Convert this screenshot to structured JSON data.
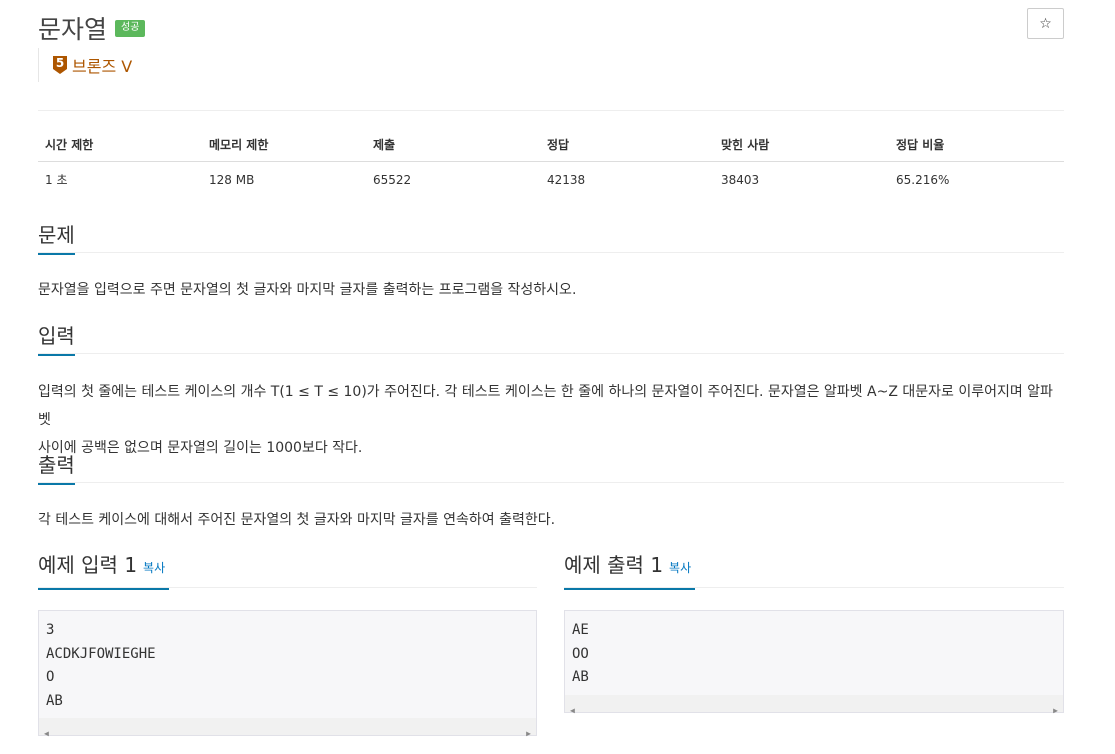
{
  "problem": {
    "title": "문자열",
    "result_badge": "성공",
    "tier_number": "5",
    "tier_label": "브론즈 V",
    "star_icon": "☆"
  },
  "info_table": {
    "headers": [
      "시간 제한",
      "메모리 제한",
      "제출",
      "정답",
      "맞힌 사람",
      "정답 비율"
    ],
    "values": [
      "1 초",
      "128 MB",
      "65522",
      "42138",
      "38403",
      "65.216%"
    ]
  },
  "sections": {
    "description": {
      "heading": "문제",
      "text": "문자열을 입력으로 주면 문자열의 첫 글자와 마지막 글자를 출력하는 프로그램을 작성하시오."
    },
    "input": {
      "heading": "입력",
      "text_line1": "입력의 첫 줄에는 테스트 케이스의 개수 T(1 ≤ T ≤ 10)가 주어진다. 각 테스트 케이스는 한 줄에 하나의 문자열이 주어진다. 문자열은 알파벳 A~Z 대문자로 이루어지며 알파벳",
      "text_line2": "사이에 공백은 없으며 문자열의 길이는 1000보다 작다."
    },
    "output": {
      "heading": "출력",
      "text": "각 테스트 케이스에 대해서 주어진 문자열의 첫 글자와 마지막 글자를 연속하여 출력한다."
    }
  },
  "samples": {
    "input": {
      "heading": "예제 입력 1",
      "copy_label": "복사",
      "lines": [
        "3",
        "ACDKJFOWIEGHE",
        "O",
        "AB"
      ]
    },
    "output": {
      "heading": "예제 출력 1",
      "copy_label": "복사",
      "lines": [
        "AE",
        "OO",
        "AB"
      ]
    }
  },
  "colors": {
    "success_badge": "#5cb85c",
    "bronze": "#ad5600",
    "link": "#0076c0"
  }
}
